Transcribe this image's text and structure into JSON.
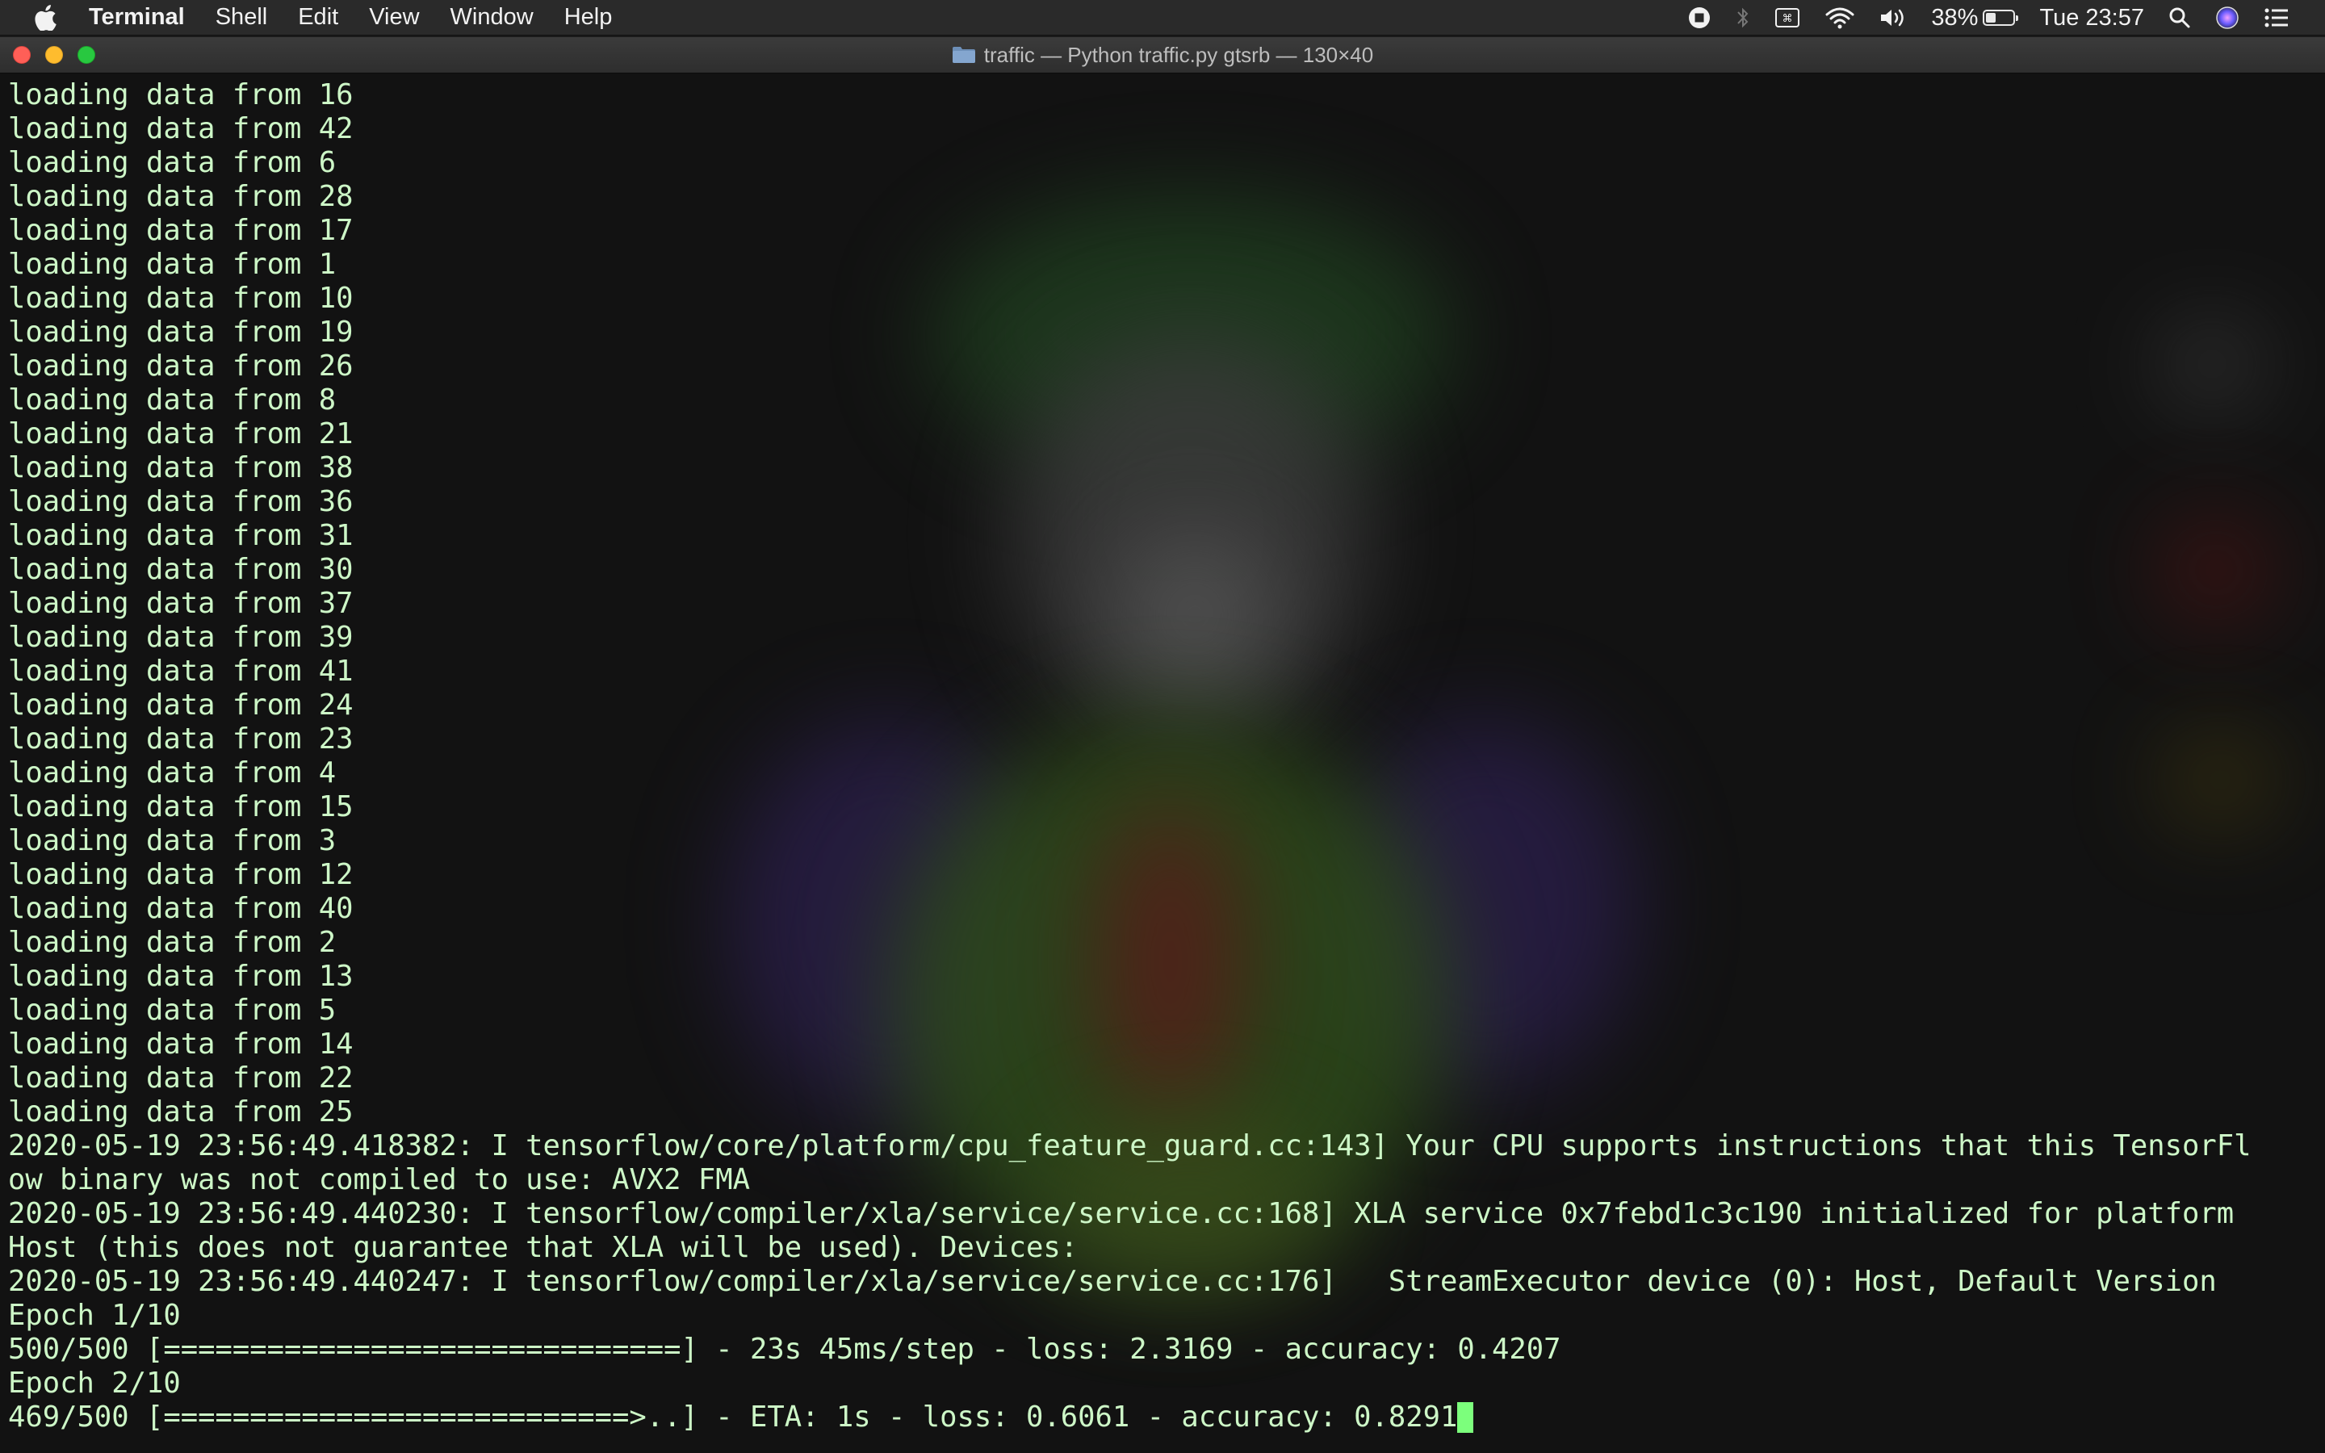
{
  "menubar": {
    "app_name": "Terminal",
    "menus": [
      "Shell",
      "Edit",
      "View",
      "Window",
      "Help"
    ],
    "battery_percent": "38%",
    "battery_level": 0.38,
    "clock": "Tue 23:57",
    "status_icons": [
      "screen-record-icon",
      "bluetooth-icon",
      "keyboard-viewer-icon",
      "wifi-icon",
      "volume-icon",
      "battery-icon",
      "spotlight-search-icon",
      "siri-icon",
      "notification-center-icon"
    ]
  },
  "window": {
    "title": "traffic — Python traffic.py gtsrb — 130×40"
  },
  "terminal": {
    "lines": [
      "loading data from 16",
      "loading data from 42",
      "loading data from 6",
      "loading data from 28",
      "loading data from 17",
      "loading data from 1",
      "loading data from 10",
      "loading data from 19",
      "loading data from 26",
      "loading data from 8",
      "loading data from 21",
      "loading data from 38",
      "loading data from 36",
      "loading data from 31",
      "loading data from 30",
      "loading data from 37",
      "loading data from 39",
      "loading data from 41",
      "loading data from 24",
      "loading data from 23",
      "loading data from 4",
      "loading data from 15",
      "loading data from 3",
      "loading data from 12",
      "loading data from 40",
      "loading data from 2",
      "loading data from 13",
      "loading data from 5",
      "loading data from 14",
      "loading data from 22",
      "loading data from 25",
      "2020-05-19 23:56:49.418382: I tensorflow/core/platform/cpu_feature_guard.cc:143] Your CPU supports instructions that this TensorFl",
      "ow binary was not compiled to use: AVX2 FMA",
      "2020-05-19 23:56:49.440230: I tensorflow/compiler/xla/service/service.cc:168] XLA service 0x7febd1c3c190 initialized for platform",
      "Host (this does not guarantee that XLA will be used). Devices:",
      "2020-05-19 23:56:49.440247: I tensorflow/compiler/xla/service/service.cc:176]   StreamExecutor device (0): Host, Default Version",
      "Epoch 1/10",
      "500/500 [==============================] - 23s 45ms/step - loss: 2.3169 - accuracy: 0.4207",
      "Epoch 2/10",
      "469/500 [===========================>..] - ETA: 1s - loss: 0.6061 - accuracy: 0.8291"
    ]
  }
}
